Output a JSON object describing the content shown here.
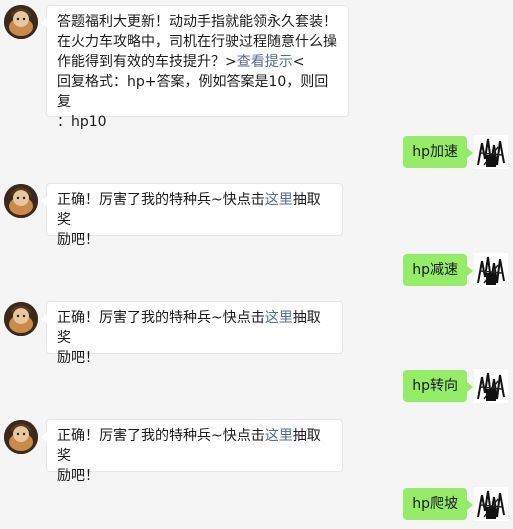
{
  "colors": {
    "background": "#f5f5f5",
    "incoming_bubble": "#ffffff",
    "outgoing_bubble": "#95ec69",
    "link": "#576b95"
  },
  "messages": [
    {
      "side": "left",
      "lines": [
        "答题福利大更新！动动手指就能领永久套装！",
        "在火力车攻略中，司机在行驶过程随意什么操",
        "作能得到有效的车技提升？"
      ],
      "link_prefix": ">",
      "link": "查看提示",
      "link_suffix": "<",
      "lines_after": [
        "回复格式：hp+答案，例如答案是10，则回复",
        "：hp10"
      ]
    },
    {
      "side": "right",
      "text": "hp加速"
    },
    {
      "side": "left",
      "prefix": "正确！厉害了我的特种兵~快点击",
      "link": "这里",
      "suffix": "抽取奖",
      "line2": "励吧！"
    },
    {
      "side": "right",
      "text": "hp减速"
    },
    {
      "side": "left",
      "prefix": "正确！厉害了我的特种兵~快点击",
      "link": "这里",
      "suffix": "抽取奖",
      "line2": "励吧！"
    },
    {
      "side": "right",
      "text": "hp转向"
    },
    {
      "side": "left",
      "prefix": "正确！厉害了我的特种兵~快点击",
      "link": "这里",
      "suffix": "抽取奖",
      "line2": "励吧！"
    },
    {
      "side": "right",
      "text": "hp爬坡"
    }
  ]
}
